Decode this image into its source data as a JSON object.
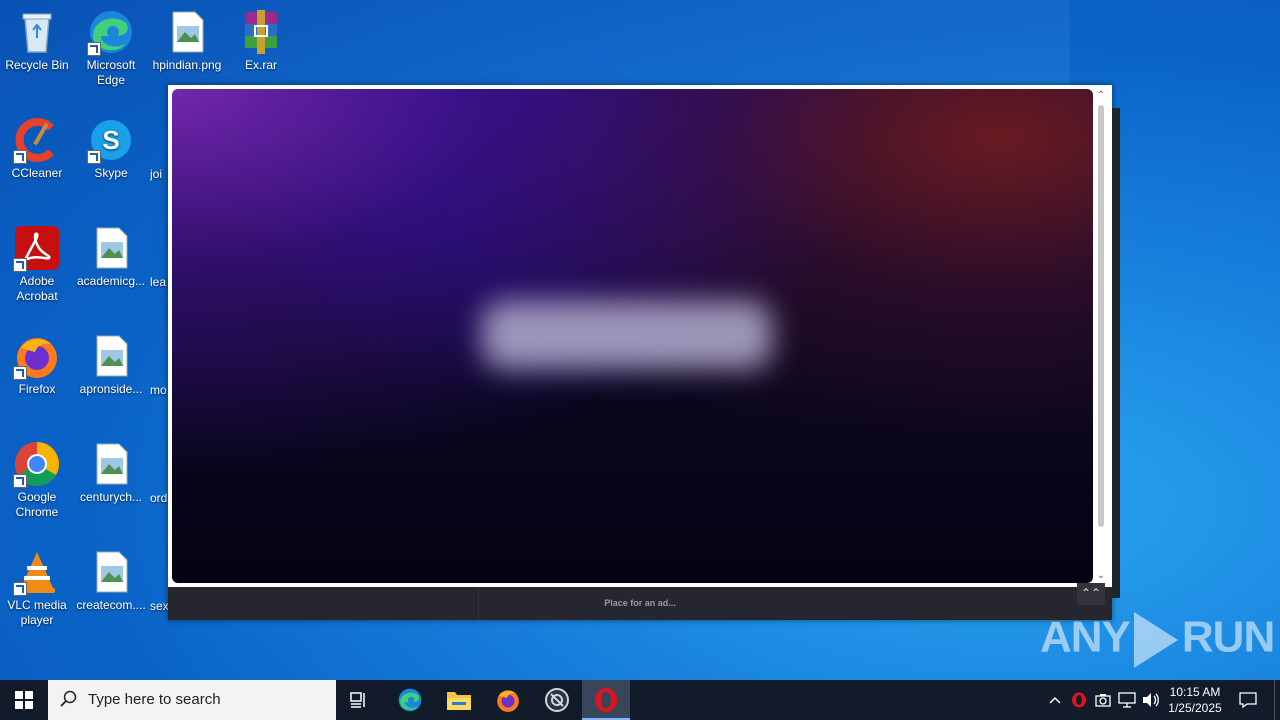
{
  "desktop": {
    "icons": [
      {
        "label": "Recycle Bin",
        "icon": "recycle-bin-icon"
      },
      {
        "label": "Microsoft Edge",
        "icon": "edge-icon"
      },
      {
        "label": "hpindian.png",
        "icon": "image-file-icon"
      },
      {
        "label": "Ex.rar",
        "icon": "winrar-icon"
      },
      {
        "label": "CCleaner",
        "icon": "ccleaner-icon"
      },
      {
        "label": "Skype",
        "icon": "skype-icon"
      },
      {
        "label": "Adobe Acrobat",
        "icon": "acrobat-icon"
      },
      {
        "label": "academicg...",
        "icon": "image-file-icon"
      },
      {
        "label": "Firefox",
        "icon": "firefox-icon"
      },
      {
        "label": "apronside...",
        "icon": "image-file-icon"
      },
      {
        "label": "Google Chrome",
        "icon": "chrome-icon"
      },
      {
        "label": "centurych...",
        "icon": "image-file-icon"
      },
      {
        "label": "VLC media player",
        "icon": "vlc-icon"
      },
      {
        "label": "createcom....",
        "icon": "image-file-icon"
      }
    ],
    "clipped_labels": [
      "joi",
      "lea",
      "mo",
      "ord",
      "sex"
    ]
  },
  "popup": {
    "ad_text": "Place for an ad...",
    "scroll_top_icon": "double-chevron-up-icon"
  },
  "watermark": {
    "left": "ANY",
    "right": "RUN"
  },
  "taskbar": {
    "search_placeholder": "Type here to search",
    "pinned": [
      "task-view-icon",
      "edge-icon",
      "file-explorer-icon",
      "firefox-icon",
      "settings-app-icon",
      "opera-icon"
    ],
    "tray_icons": [
      "chevron-up-icon",
      "opera-icon",
      "camera-icon",
      "network-icon",
      "volume-icon"
    ],
    "time": "10:15 AM",
    "date": "1/25/2025"
  },
  "colors": {
    "desktop_bg": "#0a63c7",
    "taskbar_bg": "#111b2a",
    "opera_red": "#e0141e"
  }
}
